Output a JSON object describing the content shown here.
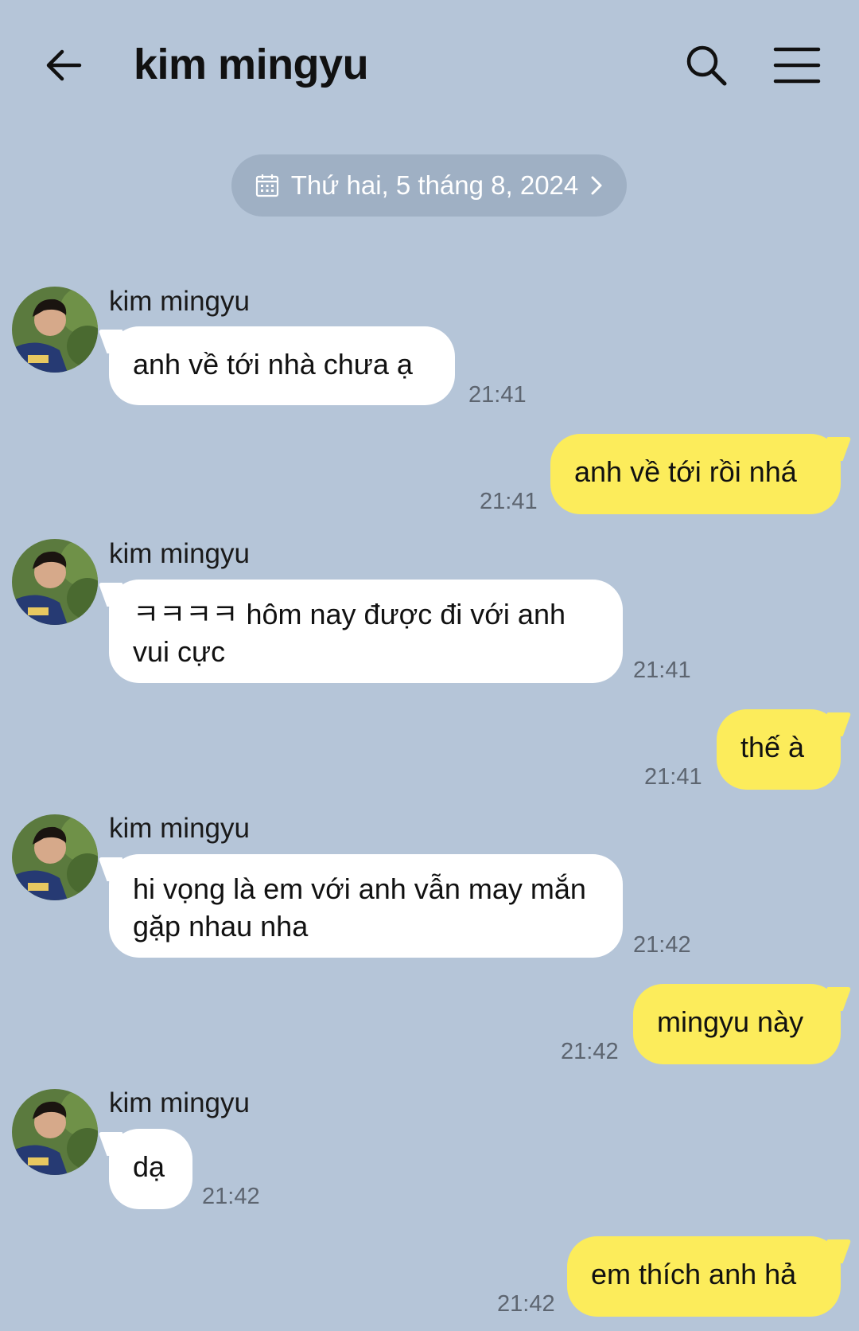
{
  "header": {
    "title": "kim mingyu",
    "back_icon": "arrow-left-icon",
    "search_icon": "search-icon",
    "menu_icon": "hamburger-menu-icon"
  },
  "date_divider": {
    "label": "Thứ hai, 5 tháng 8, 2024",
    "icon": "calendar-icon"
  },
  "colors": {
    "background": "#b5c5d8",
    "incoming_bubble": "#ffffff",
    "outgoing_bubble": "#fcec5b",
    "date_pill": "#9fb0c4"
  },
  "messages": [
    {
      "direction": "in",
      "sender": "kim mingyu",
      "text": "anh về tới nhà chưa ạ",
      "time": "21:41"
    },
    {
      "direction": "out",
      "text": "anh về tới rồi nhá",
      "time": "21:41"
    },
    {
      "direction": "in",
      "sender": "kim mingyu",
      "text": "ㅋㅋㅋㅋ hôm nay được đi với anh vui cực",
      "time": "21:41"
    },
    {
      "direction": "out",
      "text": "thế à",
      "time": "21:41"
    },
    {
      "direction": "in",
      "sender": "kim mingyu",
      "text": "hi vọng là em với anh vẫn may mắn gặp nhau nha",
      "time": "21:42"
    },
    {
      "direction": "out",
      "text": "mingyu này",
      "time": "21:42"
    },
    {
      "direction": "in",
      "sender": "kim mingyu",
      "text": "dạ",
      "time": "21:42"
    },
    {
      "direction": "out",
      "text": "em thích anh hả",
      "time": "21:42"
    }
  ]
}
